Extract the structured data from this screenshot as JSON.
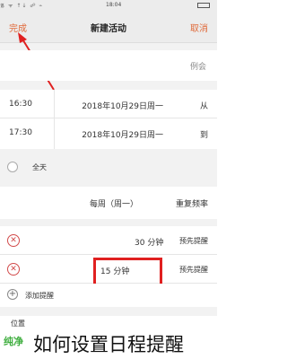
{
  "status_bar": {
    "time": "18:04",
    "icons": "᯾ ᯤ ↑↓ ☍ ⌁"
  },
  "nav": {
    "done": "完成",
    "title": "新建活动",
    "cancel": "取消"
  },
  "note_row": {
    "text": "例会"
  },
  "start": {
    "time": "16:30",
    "date": "2018年10月29日周一",
    "label": "从"
  },
  "end": {
    "time": "17:30",
    "date": "2018年10月29日周一",
    "label": "到"
  },
  "allday": {
    "label": "全天"
  },
  "repeat": {
    "value": "每周（周一）",
    "label": "重复频率"
  },
  "reminder1": {
    "value": "30 分钟",
    "label": "预先提醒"
  },
  "reminder2": {
    "value": "15 分钟",
    "label": "预先提醒"
  },
  "add_reminder": {
    "label": "添加提醒"
  },
  "footer_row": {
    "label": "位置"
  },
  "caption": {
    "text": "如何设置日程提醒"
  },
  "watermark": {
    "text": "纯净"
  },
  "colors": {
    "accent": "#e06a3a",
    "remove": "#d24b4b",
    "highlight": "#e02020"
  }
}
